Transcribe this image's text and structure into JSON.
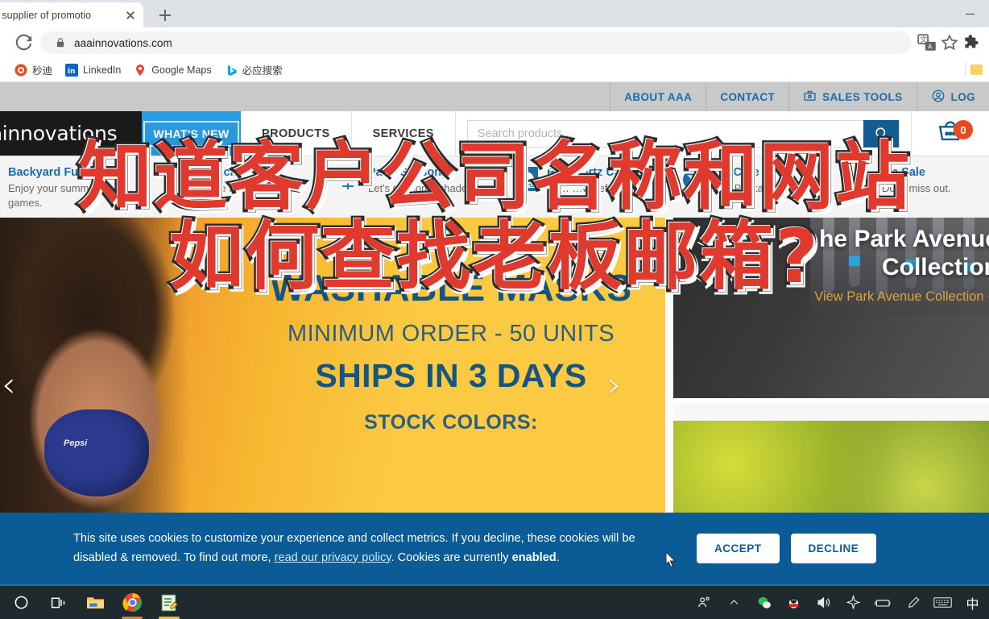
{
  "browser": {
    "tab_title": "ading supplier of promotio",
    "new_tab_label": "+",
    "url": "aaainnovations.com",
    "icons": {
      "reload": "reload-icon",
      "lock": "lock-icon",
      "translate": "translate-icon",
      "bookmark_star": "star-icon",
      "extensions": "puzzle-icon",
      "minimize": "minimize-icon"
    },
    "bookmarks": [
      {
        "label": "秒迪",
        "icon": "miaodi-icon"
      },
      {
        "label": "LinkedIn",
        "icon": "linkedin-icon"
      },
      {
        "label": "Google Maps",
        "icon": "maps-pin-icon"
      },
      {
        "label": "必应搜索",
        "icon": "bing-icon"
      }
    ]
  },
  "site": {
    "utility_nav": [
      {
        "label": "ABOUT AAA",
        "icon": null
      },
      {
        "label": "CONTACT",
        "icon": null
      },
      {
        "label": "SALES TOOLS",
        "icon": "toolbox-icon"
      },
      {
        "label": "LOG",
        "icon": "user-circle-icon"
      }
    ],
    "logo": {
      "mark": "a",
      "word": "innovations"
    },
    "main_nav": [
      {
        "label": "WHAT'S NEW",
        "active": true
      },
      {
        "label": "PRODUCTS",
        "active": false
      },
      {
        "label": "SERVICES",
        "active": false
      }
    ],
    "search": {
      "value": "",
      "placeholder": "Search products...",
      "icon": "search-icon"
    },
    "cart": {
      "count": "0",
      "icon": "basket-icon"
    },
    "categories": [
      {
        "title": "Backyard Fun",
        "sub": "Enjoy your summer games.",
        "icon": "cornhole-icon",
        "icon_hidden": true
      },
      {
        "title": "Beach Party",
        "sub": "More fun in the sun!",
        "icon": "beachball-icon"
      },
      {
        "title": "Patio Season",
        "sub": "Let's get some shade.",
        "icon": "patio-umbrella-icon"
      },
      {
        "title": "Rainalertz Umbrellas",
        "sub": "Yo…  …w befo…",
        "icon": "rainalertz-icon"
      },
      {
        "title": "We Care",
        "sub": "Eco-Packaging",
        "icon": "globe-icon"
      },
      {
        "title": "On Sale",
        "sub": "Don't miss out.",
        "icon": "price-tag-icon"
      }
    ],
    "hero": {
      "line1": "WASHABLE MASKS",
      "line2": "MINIMUM ORDER - 50 UNITS",
      "line3": "SHIPS IN 3 DAYS",
      "line4": "STOCK COLORS:",
      "mask_brand": "Pepsi",
      "prev_arrow": "‹",
      "next_arrow": "›"
    },
    "park_avenue": {
      "title_line1": "he Park Avenue",
      "title_line2": "Collection",
      "link": "View Park Avenue Collection ⊕"
    },
    "cookie": {
      "text_1": "This site uses cookies to customize your experience and collect metrics. If you decline, these cookies will be disabled & removed. To find out more, ",
      "link": "read our privacy policy",
      "text_2": ". Cookies are currently ",
      "strong": "enabled",
      "text_3": ".",
      "accept": "ACCEPT",
      "decline": "DECLINE"
    }
  },
  "overlay": {
    "line1": "知道客户公司名称和网站",
    "line2": "如何查找老板邮箱?",
    "color": "#e03a2f",
    "stroke": "#2b2b2b"
  },
  "taskbar": {
    "left_items": [
      {
        "name": "start-button",
        "icon": "windows-circle-icon"
      },
      {
        "name": "task-view-button",
        "icon": "task-view-icon"
      },
      {
        "name": "file-explorer-button",
        "icon": "folder-icon"
      },
      {
        "name": "chrome-button",
        "icon": "chrome-icon"
      },
      {
        "name": "notepad-button",
        "icon": "editor-icon"
      }
    ],
    "tray_items": [
      {
        "name": "people-icon",
        "glyph": "👤"
      },
      {
        "name": "show-hidden-icons-chevron",
        "glyph": "∧"
      },
      {
        "name": "wechat-icon",
        "glyph": "●"
      },
      {
        "name": "qq-icon",
        "glyph": "🐧"
      },
      {
        "name": "volume-icon",
        "glyph": "🔊"
      },
      {
        "name": "airplane-mode-icon",
        "glyph": "✈"
      },
      {
        "name": "battery-icon",
        "glyph": "▭"
      },
      {
        "name": "pen-icon",
        "glyph": "✎"
      },
      {
        "name": "keyboard-icon",
        "glyph": "⌨"
      },
      {
        "name": "ime-indicator",
        "glyph": "中"
      }
    ]
  },
  "colors": {
    "brand_blue": "#1b6ca8",
    "nav_active": "#2a9fe0",
    "cookie_bg": "#0b5c96",
    "cart_badge": "#e8491d",
    "hero_yellow": "#fcc943"
  }
}
